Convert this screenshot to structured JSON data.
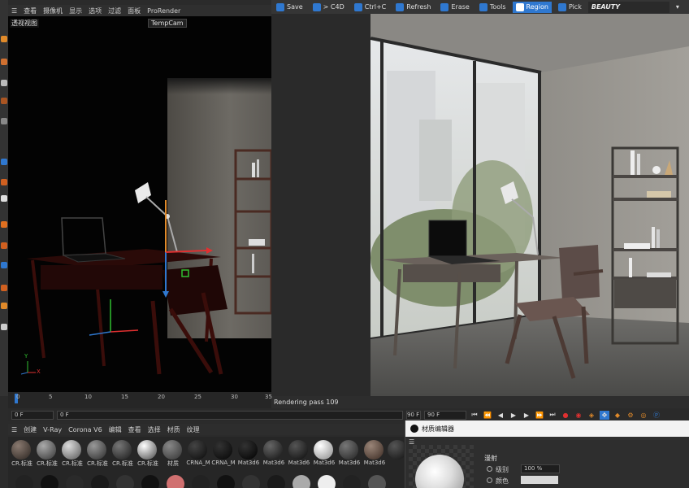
{
  "viewport": {
    "menu": [
      "查看",
      "摄像机",
      "显示",
      "选项",
      "过滤",
      "面板",
      "ProRender"
    ],
    "label": "透视视图",
    "camera": "TempCam",
    "axes": {
      "y": "Y",
      "x": "X"
    }
  },
  "render_toolbar": {
    "buttons": [
      "Save",
      "> C4D",
      "Ctrl+C",
      "Refresh",
      "Erase",
      "Tools",
      "Region",
      "Pick"
    ],
    "active": "Region",
    "pass": "BEAUTY"
  },
  "status": "Rendering pass 109",
  "timeline": {
    "ticks": [
      "0",
      "5",
      "10",
      "15",
      "20",
      "25",
      "30",
      "35"
    ],
    "start_frame": "0 F",
    "current_frame": "0 F",
    "end_frame": "90 F",
    "end_frame2": "90 F"
  },
  "material_menu": [
    "创建",
    "V-Ray",
    "Corona V6",
    "编辑",
    "查看",
    "选择",
    "材质",
    "纹理"
  ],
  "materials": [
    "CR.标准",
    "CR.标准",
    "CR.标准",
    "CR.标准",
    "CR.标准",
    "CR.标准",
    "材质",
    "CRNA_M",
    "CRNA_M",
    "Mat3d6",
    "Mat3d6",
    "Mat3d6",
    "Mat3d6",
    "Mat3d6",
    "Mat3d6"
  ],
  "editor": {
    "title": "材质编辑器",
    "section": "漫射",
    "level_label": "级别",
    "level_value": "100 %",
    "color_label": "颜色"
  },
  "colors": {
    "accent": "#2f78d0",
    "render_bg": "#8f8d89",
    "viewport_bg": "#030303"
  }
}
